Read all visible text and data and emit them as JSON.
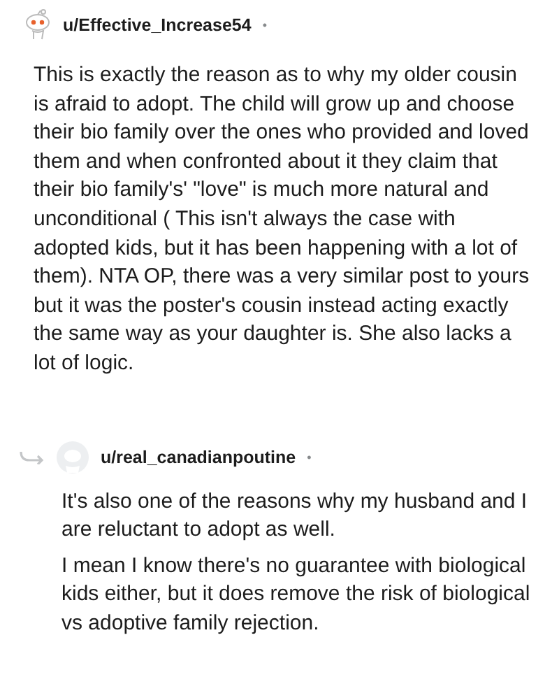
{
  "comments": [
    {
      "username": "u/Effective_Increase54",
      "separator": "•",
      "reply": false,
      "paragraphs": [
        "This is exactly the reason as to why my older cousin is afraid to adopt. The child will grow up and choose their bio family over the ones who provided and loved them and when confronted about it they claim that their bio family's' \"love\" is much more natural and unconditional ( This isn't always the case with adopted kids, but it has been happening with a lot of them). NTA OP, there was a very similar post to yours but it was the poster's cousin instead acting exactly the same way as your daughter is. She also lacks a lot of logic."
      ]
    },
    {
      "username": "u/real_canadianpoutine",
      "separator": "•",
      "reply": true,
      "paragraphs": [
        "It's also one of the reasons why my husband and I are reluctant to adopt as well.",
        "I mean I know there's no guarantee with biological kids either, but it does remove the risk of biological vs adoptive family rejection."
      ]
    }
  ]
}
